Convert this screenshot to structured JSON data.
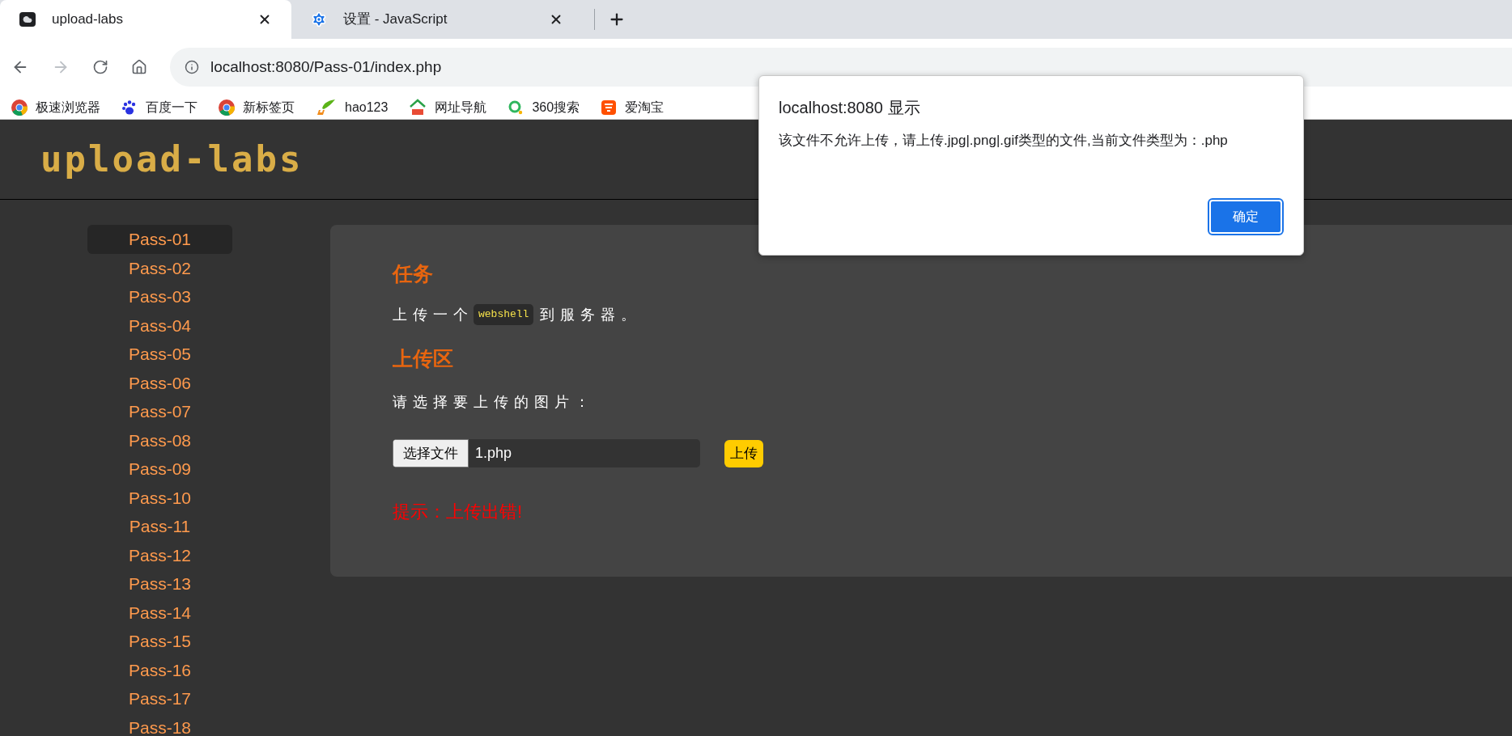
{
  "tabs": [
    {
      "title": "upload-labs",
      "selected": true,
      "kind": "cloud"
    },
    {
      "title": "设置 - JavaScript",
      "selected": false,
      "kind": "gear"
    }
  ],
  "address": "localhost:8080/Pass-01/index.php",
  "bookmarks": [
    {
      "label": "极速浏览器",
      "kind": "chrome"
    },
    {
      "label": "百度一下",
      "kind": "paw"
    },
    {
      "label": "新标签页",
      "kind": "chrome"
    },
    {
      "label": "hao123",
      "kind": "hao"
    },
    {
      "label": "网址导航",
      "kind": "house"
    },
    {
      "label": "360搜索",
      "kind": "ring"
    },
    {
      "label": "爱淘宝",
      "kind": "tao"
    }
  ],
  "logo": "upload-labs",
  "sidebar": {
    "items": [
      {
        "label": "Pass-01",
        "selected": true
      },
      {
        "label": "Pass-02",
        "selected": false
      },
      {
        "label": "Pass-03",
        "selected": false
      },
      {
        "label": "Pass-04",
        "selected": false
      },
      {
        "label": "Pass-05",
        "selected": false
      },
      {
        "label": "Pass-06",
        "selected": false
      },
      {
        "label": "Pass-07",
        "selected": false
      },
      {
        "label": "Pass-08",
        "selected": false
      },
      {
        "label": "Pass-09",
        "selected": false
      },
      {
        "label": "Pass-10",
        "selected": false
      },
      {
        "label": "Pass-11",
        "selected": false
      },
      {
        "label": "Pass-12",
        "selected": false
      },
      {
        "label": "Pass-13",
        "selected": false
      },
      {
        "label": "Pass-14",
        "selected": false
      },
      {
        "label": "Pass-15",
        "selected": false
      },
      {
        "label": "Pass-16",
        "selected": false
      },
      {
        "label": "Pass-17",
        "selected": false
      },
      {
        "label": "Pass-18",
        "selected": false
      }
    ]
  },
  "task": {
    "heading": "任务",
    "before": "上传一个",
    "code": "webshell",
    "after": "到服务器。"
  },
  "upload": {
    "heading": "上传区",
    "prompt": "请选择要上传的图片：",
    "choose_button": "选择文件",
    "file_name": "1.php",
    "submit": "上传",
    "message": "提示：上传出错!"
  },
  "dialog": {
    "title": "localhost:8080 显示",
    "message": "该文件不允许上传，请上传.jpg|.png|.gif类型的文件,当前文件类型为：.php",
    "ok": "确定"
  }
}
